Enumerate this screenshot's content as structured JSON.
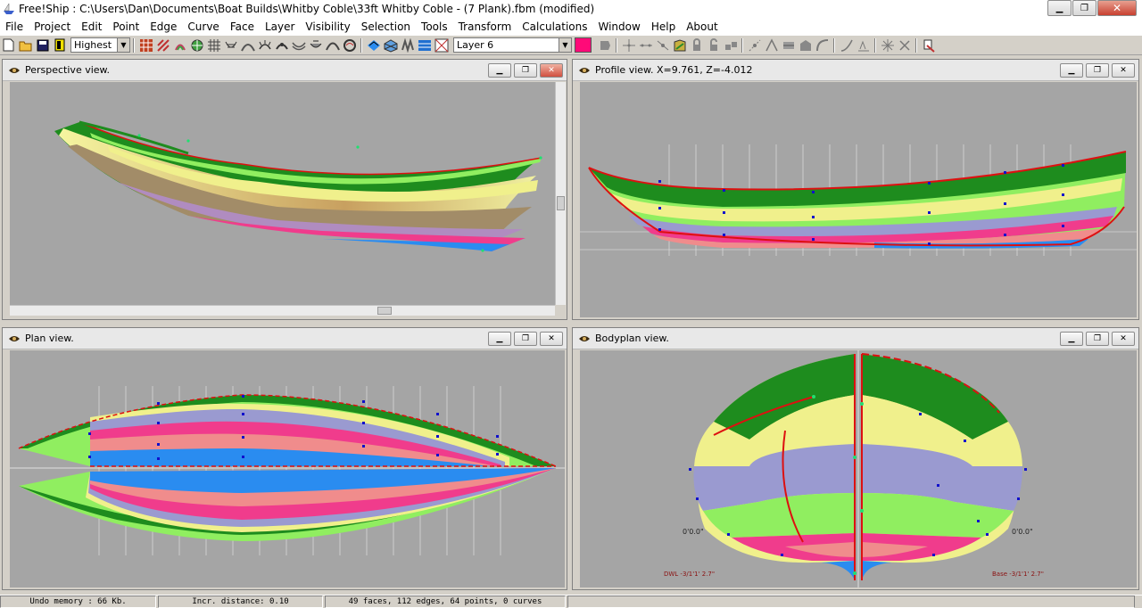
{
  "window": {
    "title": "Free!Ship  : C:\\Users\\Dan\\Documents\\Boat Builds\\Whitby Coble\\33ft Whitby Coble - (7 Plank).fbm (modified)",
    "minimize_label": "▁",
    "maximize_label": "❐",
    "close_label": "✕"
  },
  "menu": [
    "File",
    "Project",
    "Edit",
    "Point",
    "Edge",
    "Curve",
    "Face",
    "Layer",
    "Visibility",
    "Selection",
    "Tools",
    "Transform",
    "Calculations",
    "Window",
    "Help",
    "About"
  ],
  "toolbar": {
    "precision_value": "Highest",
    "layer_value": "Layer 6",
    "layer_color": "#ff0a78"
  },
  "panes": {
    "perspective": {
      "title": "Perspective view."
    },
    "profile": {
      "title": "Profile view.  X=9.761,   Z=-4.012"
    },
    "plan": {
      "title": "Plan view."
    },
    "bodyplan": {
      "title": "Bodyplan view.",
      "left_dim": "0'0.0\"",
      "right_dim": "0'0.0\"",
      "dwl_label": "DWL -3/1'1' 2.7\"",
      "base_label": "Base -3/1'1' 2.7\""
    }
  },
  "pane_buttons": {
    "min": "▁",
    "max": "❐",
    "close": "✕"
  },
  "status": {
    "undo": "Undo memory : 66 Kb.",
    "incr": "Incr. distance: 0.10",
    "counts": "49 faces, 112 edges, 64 points, 0 curves"
  },
  "colors": {
    "hull_green": "#1e8c1e",
    "light_green": "#90ee60",
    "yellow": "#f0f08c",
    "lavender": "#9a9ad0",
    "pink": "#f03c8c",
    "salmon": "#f08c8c",
    "blue": "#2a8cf0",
    "edge_red": "#dd1010",
    "point_blue": "#1010cc",
    "point_green": "#20e070",
    "canvas_gray": "#a5a5a5"
  }
}
